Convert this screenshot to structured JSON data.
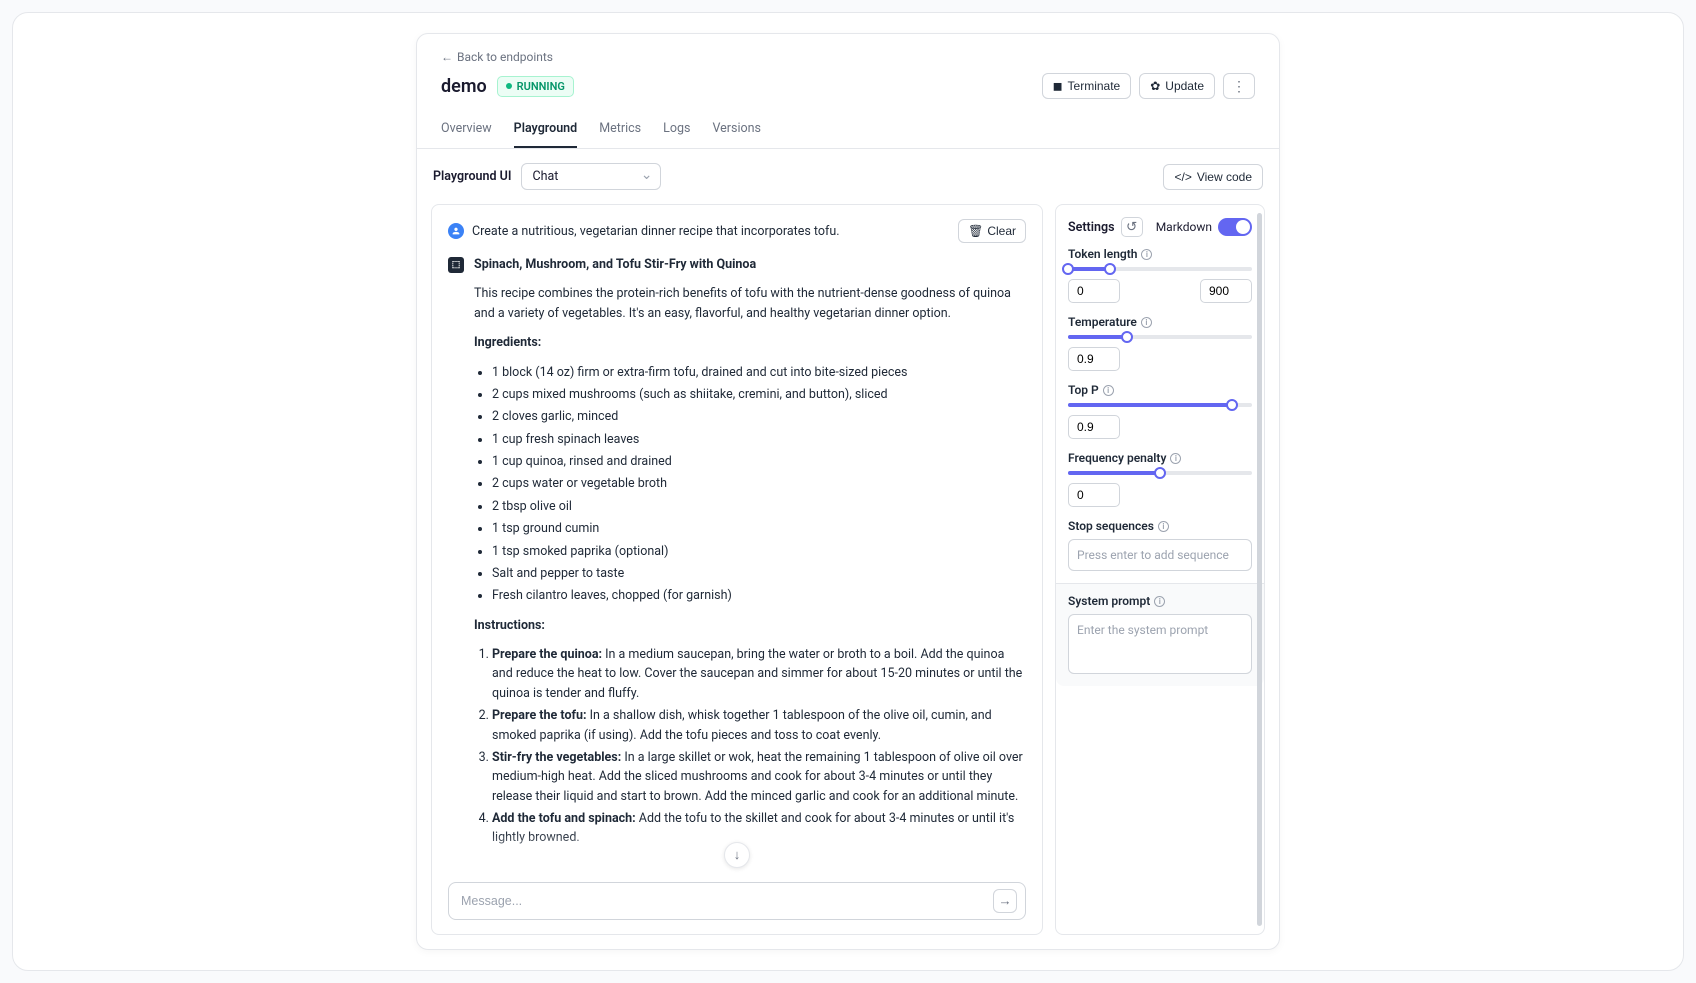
{
  "back_label": "Back to endpoints",
  "page_title": "demo",
  "status": "RUNNING",
  "actions": {
    "terminate": "Terminate",
    "update": "Update"
  },
  "tabs": [
    "Overview",
    "Playground",
    "Metrics",
    "Logs",
    "Versions"
  ],
  "active_tab": "Playground",
  "toolbar": {
    "label": "Playground UI",
    "dropdown_value": "Chat",
    "view_code": "View code"
  },
  "chat": {
    "user_message": "Create a nutritious, vegetarian dinner recipe that incorporates tofu.",
    "clear": "Clear",
    "title": "Spinach, Mushroom, and Tofu Stir-Fry with Quinoa",
    "intro": "This recipe combines the protein-rich benefits of tofu with the nutrient-dense goodness of quinoa and a variety of vegetables. It's an easy, flavorful, and healthy vegetarian dinner option.",
    "ingredients_label": "Ingredients:",
    "ingredients": [
      "1 block (14 oz) firm or extra-firm tofu, drained and cut into bite-sized pieces",
      "2 cups mixed mushrooms (such as shiitake, cremini, and button), sliced",
      "2 cloves garlic, minced",
      "1 cup fresh spinach leaves",
      "1 cup quinoa, rinsed and drained",
      "2 cups water or vegetable broth",
      "2 tbsp olive oil",
      "1 tsp ground cumin",
      "1 tsp smoked paprika (optional)",
      "Salt and pepper to taste",
      "Fresh cilantro leaves, chopped (for garnish)"
    ],
    "instructions_label": "Instructions:",
    "instructions": [
      {
        "name": "Prepare the quinoa:",
        "text": " In a medium saucepan, bring the water or broth to a boil. Add the quinoa and reduce the heat to low. Cover the saucepan and simmer for about 15-20 minutes or until the quinoa is tender and fluffy."
      },
      {
        "name": "Prepare the tofu:",
        "text": " In a shallow dish, whisk together 1 tablespoon of the olive oil, cumin, and smoked paprika (if using). Add the tofu pieces and toss to coat evenly."
      },
      {
        "name": "Stir-fry the vegetables:",
        "text": " In a large skillet or wok, heat the remaining 1 tablespoon of olive oil over medium-high heat. Add the sliced mushrooms and cook for about 3-4 minutes or until they release their liquid and start to brown. Add the minced garlic and cook for an additional minute."
      },
      {
        "name": "Add the tofu and spinach:",
        "text": " Add the tofu to the skillet and cook for about 3-4 minutes or until it's lightly browned."
      }
    ],
    "input_placeholder": "Message..."
  },
  "settings": {
    "header": "Settings",
    "markdown_label": "Markdown",
    "markdown_on": true,
    "token_length": {
      "label": "Token length",
      "min": "0",
      "max": "900",
      "fill_pct": 23
    },
    "temperature": {
      "label": "Temperature",
      "value": "0.9",
      "fill_pct": 32
    },
    "top_p": {
      "label": "Top P",
      "value": "0.9",
      "fill_pct": 89
    },
    "frequency_penalty": {
      "label": "Frequency penalty",
      "value": "0",
      "fill_pct": 50
    },
    "stop_sequences": {
      "label": "Stop sequences",
      "placeholder": "Press enter to add sequence"
    },
    "system_prompt": {
      "label": "System prompt",
      "placeholder": "Enter the system prompt"
    }
  }
}
